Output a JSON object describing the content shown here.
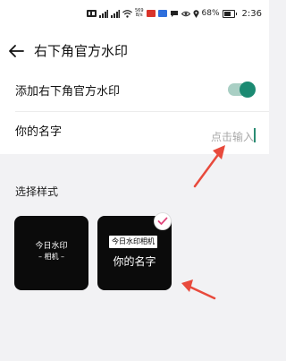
{
  "status_bar": {
    "net_speed_value": "569",
    "net_speed_unit": "B/s",
    "battery_percent": "68%",
    "time": "2:36"
  },
  "nav": {
    "title": "右下角官方水印"
  },
  "settings": {
    "add_watermark_label": "添加右下角官方水印",
    "add_watermark_enabled": true,
    "name_label": "你的名字",
    "name_placeholder": "点击输入",
    "name_value": ""
  },
  "styles": {
    "section_label": "选择样式",
    "options": [
      {
        "line1": "今日水印",
        "line2": "– 相机 –"
      },
      {
        "tag": "今日水印相机",
        "name": "你的名字"
      }
    ],
    "selected_index": 1
  },
  "colors": {
    "accent": "#1b8a72",
    "toggle_track": "#a9cfc4",
    "check_mark": "#e0457b",
    "annotation_arrow": "#e84a3c",
    "card_bg": "#0b0b0b"
  }
}
